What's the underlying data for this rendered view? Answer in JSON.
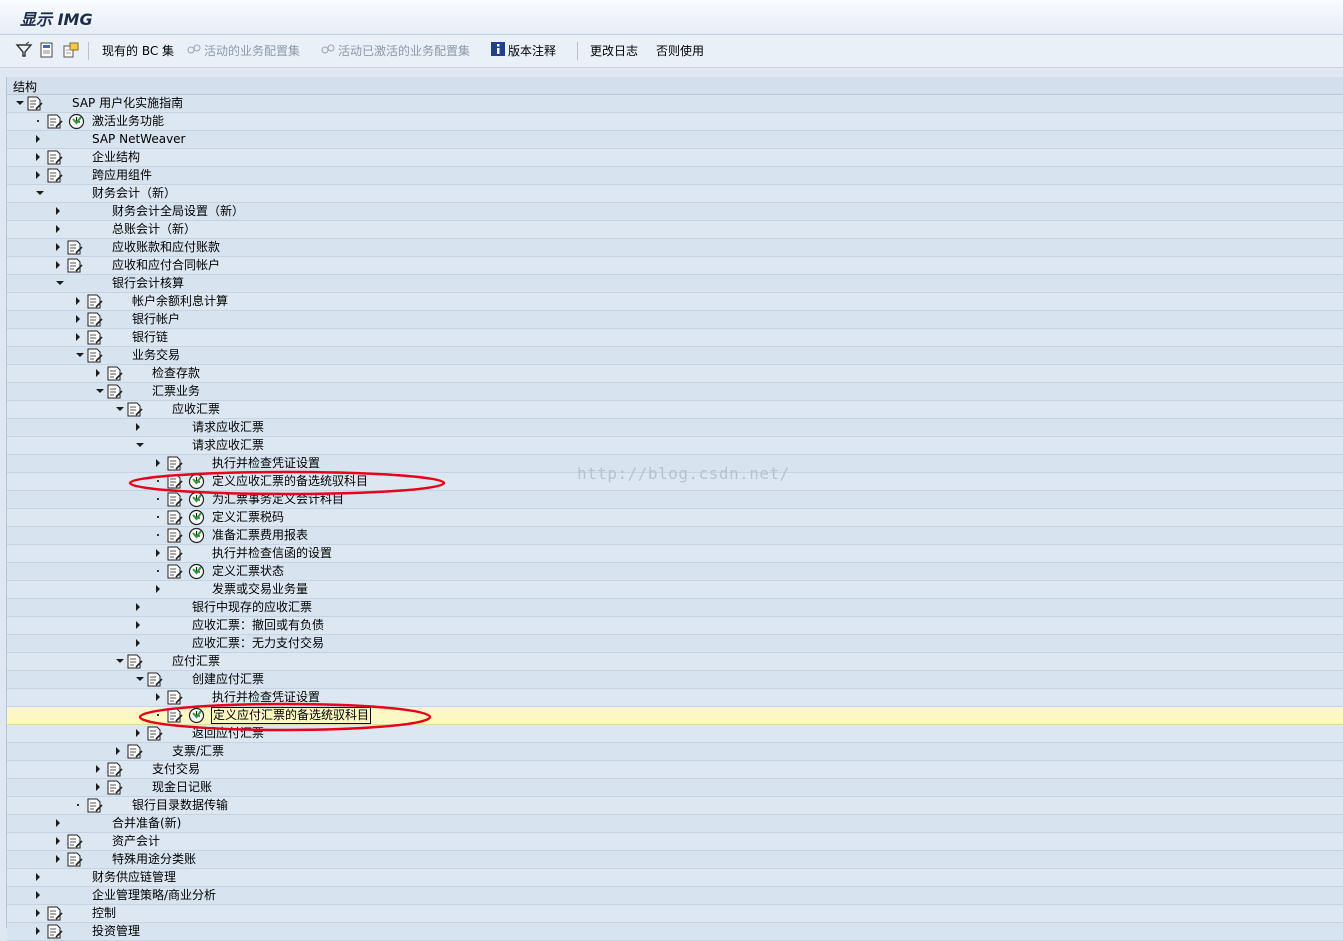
{
  "window": {
    "title": "显示 IMG"
  },
  "toolbar": {
    "bc_sets": "现有的 BC 集",
    "active_bc": "活动的业务配置集",
    "activated_bc": "活动已激活的业务配置集",
    "release_notes": "版本注释",
    "change_log": "更改日志",
    "otherwise": "否则使用"
  },
  "tree": {
    "header": "结构",
    "rows": [
      {
        "text": "SAP 用户化实施指南",
        "level": 0,
        "toggle": "e",
        "doc": true,
        "clock": false
      },
      {
        "text": "激活业务功能",
        "level": 1,
        "toggle": "l",
        "doc": true,
        "clock": true
      },
      {
        "text": "SAP NetWeaver",
        "level": 1,
        "toggle": "c",
        "doc": false,
        "clock": false
      },
      {
        "text": "企业结构",
        "level": 1,
        "toggle": "c",
        "doc": true,
        "clock": false
      },
      {
        "text": "跨应用组件",
        "level": 1,
        "toggle": "c",
        "doc": true,
        "clock": false
      },
      {
        "text": "财务会计（新）",
        "level": 1,
        "toggle": "e",
        "doc": false,
        "clock": false
      },
      {
        "text": "财务会计全局设置（新）",
        "level": 2,
        "toggle": "c",
        "doc": false,
        "clock": false
      },
      {
        "text": "总账会计（新）",
        "level": 2,
        "toggle": "c",
        "doc": false,
        "clock": false
      },
      {
        "text": "应收账款和应付账款",
        "level": 2,
        "toggle": "c",
        "doc": true,
        "clock": false
      },
      {
        "text": "应收和应付合同帐户",
        "level": 2,
        "toggle": "c",
        "doc": true,
        "clock": false
      },
      {
        "text": "银行会计核算",
        "level": 2,
        "toggle": "e",
        "doc": false,
        "clock": false
      },
      {
        "text": "帐户余额利息计算",
        "level": 3,
        "toggle": "c",
        "doc": true,
        "clock": false
      },
      {
        "text": "银行帐户",
        "level": 3,
        "toggle": "c",
        "doc": true,
        "clock": false
      },
      {
        "text": "银行链",
        "level": 3,
        "toggle": "c",
        "doc": true,
        "clock": false
      },
      {
        "text": "业务交易",
        "level": 3,
        "toggle": "e",
        "doc": true,
        "clock": false
      },
      {
        "text": "检查存款",
        "level": 4,
        "toggle": "c",
        "doc": true,
        "clock": false
      },
      {
        "text": "汇票业务",
        "level": 4,
        "toggle": "e",
        "doc": true,
        "clock": false
      },
      {
        "text": "应收汇票",
        "level": 5,
        "toggle": "e",
        "doc": true,
        "clock": false
      },
      {
        "text": "请求应收汇票",
        "level": 6,
        "toggle": "c",
        "doc": false,
        "clock": false
      },
      {
        "text": "请求应收汇票",
        "level": 6,
        "toggle": "e",
        "doc": false,
        "clock": false
      },
      {
        "text": "执行并检查凭证设置",
        "level": 7,
        "toggle": "c",
        "doc": true,
        "clock": false
      },
      {
        "text": "定义应收汇票的备选统驭科目",
        "level": 7,
        "toggle": "l",
        "doc": true,
        "clock": true
      },
      {
        "text": "为汇票事务定义会计科目",
        "level": 7,
        "toggle": "l",
        "doc": true,
        "clock": true
      },
      {
        "text": "定义汇票税码",
        "level": 7,
        "toggle": "l",
        "doc": true,
        "clock": true
      },
      {
        "text": "准备汇票费用报表",
        "level": 7,
        "toggle": "l",
        "doc": true,
        "clock": true
      },
      {
        "text": "执行并检查信函的设置",
        "level": 7,
        "toggle": "c",
        "doc": true,
        "clock": false
      },
      {
        "text": "定义汇票状态",
        "level": 7,
        "toggle": "l",
        "doc": true,
        "clock": true
      },
      {
        "text": "发票或交易业务量",
        "level": 7,
        "toggle": "c",
        "doc": false,
        "clock": false
      },
      {
        "text": "银行中现存的应收汇票",
        "level": 6,
        "toggle": "c",
        "doc": false,
        "clock": false
      },
      {
        "text": "应收汇票：撤回或有负债",
        "level": 6,
        "toggle": "c",
        "doc": false,
        "clock": false
      },
      {
        "text": "应收汇票：无力支付交易",
        "level": 6,
        "toggle": "c",
        "doc": false,
        "clock": false
      },
      {
        "text": "应付汇票",
        "level": 5,
        "toggle": "e",
        "doc": true,
        "clock": false
      },
      {
        "text": "创建应付汇票",
        "level": 6,
        "toggle": "e",
        "doc": true,
        "clock": false
      },
      {
        "text": "执行并检查凭证设置",
        "level": 7,
        "toggle": "c",
        "doc": true,
        "clock": false
      },
      {
        "text": "定义应付汇票的备选统驭科目",
        "level": 7,
        "toggle": "l",
        "doc": true,
        "clock": true,
        "selected": true
      },
      {
        "text": "返回应付汇票",
        "level": 6,
        "toggle": "c",
        "doc": true,
        "clock": false
      },
      {
        "text": "支票/汇票",
        "level": 5,
        "toggle": "c",
        "doc": true,
        "clock": false
      },
      {
        "text": "支付交易",
        "level": 4,
        "toggle": "c",
        "doc": true,
        "clock": false
      },
      {
        "text": "现金日记账",
        "level": 4,
        "toggle": "c",
        "doc": true,
        "clock": false
      },
      {
        "text": "银行目录数据传输",
        "level": 3,
        "toggle": "l",
        "doc": true,
        "clock": false
      },
      {
        "text": "合并准备(新)",
        "level": 2,
        "toggle": "c",
        "doc": false,
        "clock": false
      },
      {
        "text": "资产会计",
        "level": 2,
        "toggle": "c",
        "doc": true,
        "clock": false
      },
      {
        "text": "特殊用途分类账",
        "level": 2,
        "toggle": "c",
        "doc": true,
        "clock": false
      },
      {
        "text": "财务供应链管理",
        "level": 1,
        "toggle": "c",
        "doc": false,
        "clock": false
      },
      {
        "text": "企业管理策略/商业分析",
        "level": 1,
        "toggle": "c",
        "doc": false,
        "clock": false
      },
      {
        "text": "控制",
        "level": 1,
        "toggle": "c",
        "doc": true,
        "clock": false
      },
      {
        "text": "投资管理",
        "level": 1,
        "toggle": "c",
        "doc": true,
        "clock": false
      }
    ]
  },
  "watermark": "http://blog.csdn.net/",
  "colors": {
    "annotation": "#e8001a",
    "selected_row": "#fbf8c4",
    "clock": "#2e9e36"
  }
}
